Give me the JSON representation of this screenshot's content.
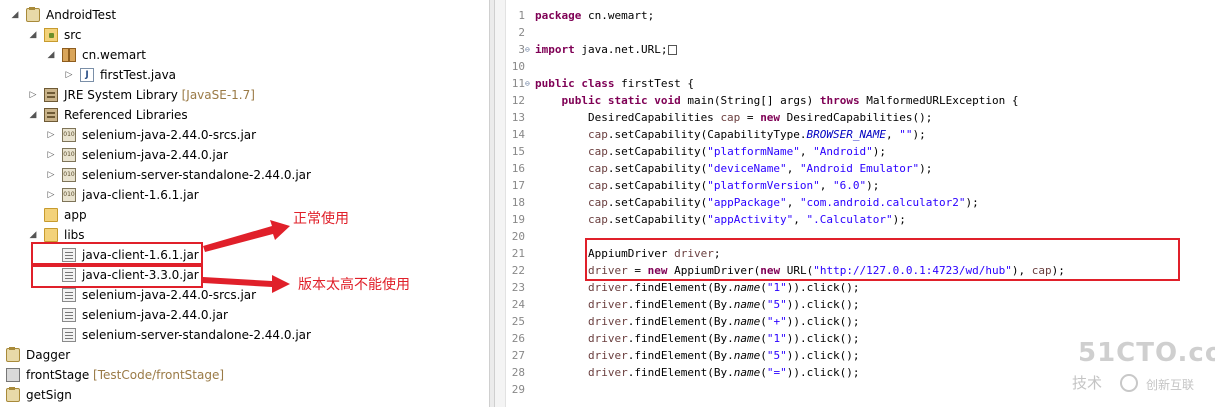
{
  "tree": [
    {
      "label": "AndroidTest",
      "icon": "project-icon",
      "twisty": "expanded"
    },
    {
      "label": "src",
      "icon": "source-folder-icon",
      "twisty": "expanded"
    },
    {
      "label": "cn.wemart",
      "icon": "package-icon",
      "twisty": "expanded"
    },
    {
      "label": "firstTest.java",
      "icon": "java-file-icon",
      "twisty": "collapsed"
    },
    {
      "label": "JRE System Library",
      "decoration": "[JavaSE-1.7]",
      "icon": "library-icon",
      "twisty": "collapsed"
    },
    {
      "label": "Referenced Libraries",
      "icon": "library-icon",
      "twisty": "expanded"
    },
    {
      "label": "selenium-java-2.44.0-srcs.jar",
      "icon": "jar-icon",
      "twisty": "collapsed"
    },
    {
      "label": "selenium-java-2.44.0.jar",
      "icon": "jar-icon",
      "twisty": "collapsed"
    },
    {
      "label": "selenium-server-standalone-2.44.0.jar",
      "icon": "jar-icon",
      "twisty": "collapsed"
    },
    {
      "label": "java-client-1.6.1.jar",
      "icon": "jar-icon",
      "twisty": "collapsed"
    },
    {
      "label": "app",
      "icon": "folder-icon",
      "twisty": "none"
    },
    {
      "label": "libs",
      "icon": "folder-icon",
      "twisty": "expanded"
    },
    {
      "label": "java-client-1.6.1.jar",
      "icon": "jar-file-icon",
      "twisty": "none"
    },
    {
      "label": "java-client-3.3.0.jar",
      "icon": "jar-file-icon",
      "twisty": "none"
    },
    {
      "label": "selenium-java-2.44.0-srcs.jar",
      "icon": "jar-file-icon",
      "twisty": "none"
    },
    {
      "label": "selenium-java-2.44.0.jar",
      "icon": "jar-file-icon",
      "twisty": "none"
    },
    {
      "label": "selenium-server-standalone-2.44.0.jar",
      "icon": "jar-file-icon",
      "twisty": "none"
    },
    {
      "label": "Dagger",
      "icon": "project-icon",
      "twisty": "none"
    },
    {
      "label": "frontStage",
      "decoration": "[TestCode/frontStage]",
      "icon": "versioned-project-icon",
      "twisty": "none"
    },
    {
      "label": "getSign",
      "icon": "project-icon",
      "twisty": "none"
    }
  ],
  "annotations": {
    "normal_use": "正常使用",
    "version_too_high": "版本太高不能使用"
  },
  "colors": {
    "annotation_red": "#e0202a",
    "keyword": "#7f0055",
    "string": "#2a00ff",
    "field": "#0000c0"
  },
  "editor": {
    "line_numbers": [
      "1",
      "2",
      "3",
      "10",
      "11",
      "12",
      "13",
      "14",
      "15",
      "16",
      "17",
      "18",
      "19",
      "20",
      "21",
      "22",
      "23",
      "24",
      "25",
      "26",
      "27",
      "28",
      "29"
    ],
    "lines": [
      "package cn.wemart;",
      "",
      "import java.net.URL;",
      "",
      "public class firstTest {",
      "    public static void main(String[] args) throws MalformedURLException {",
      "        DesiredCapabilities cap = new DesiredCapabilities();",
      "        cap.setCapability(CapabilityType.BROWSER_NAME, \"\");",
      "        cap.setCapability(\"platformName\", \"Android\");",
      "        cap.setCapability(\"deviceName\", \"Android Emulator\");",
      "        cap.setCapability(\"platformVersion\", \"6.0\");",
      "        cap.setCapability(\"appPackage\", \"com.android.calculator2\");",
      "        cap.setCapability(\"appActivity\", \".Calculator\");",
      "",
      "        AppiumDriver driver;",
      "        driver = new AppiumDriver(new URL(\"http://127.0.0.1:4723/wd/hub\"), cap);",
      "        driver.findElement(By.name(\"1\")).click();",
      "        driver.findElement(By.name(\"5\")).click();",
      "        driver.findElement(By.name(\"+\")).click();",
      "        driver.findElement(By.name(\"1\")).click();",
      "        driver.findElement(By.name(\"5\")).click();",
      "        driver.findElement(By.name(\"=\")).click();",
      "",
      "    }"
    ]
  },
  "watermark": {
    "brand": "51CTO.com",
    "line2": "技术",
    "line3": "创新互联"
  }
}
